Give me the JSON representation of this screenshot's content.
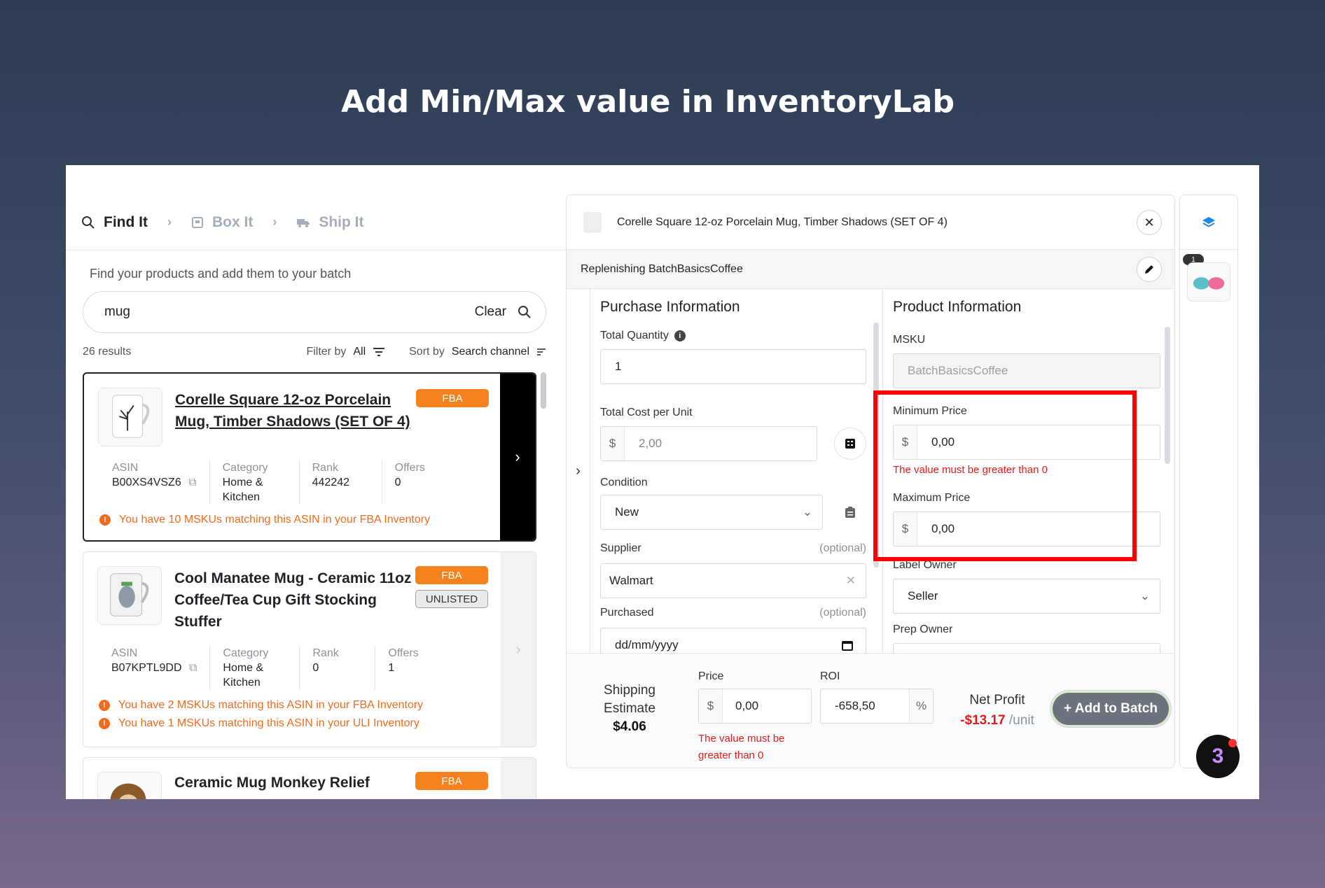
{
  "headline": "Add Min/Max value in InventoryLab",
  "steps": [
    {
      "label": "Find It",
      "icon": "search-icon",
      "active": true
    },
    {
      "label": "Box It",
      "icon": "box-icon",
      "active": false
    },
    {
      "label": "Ship It",
      "icon": "truck-icon",
      "active": false
    }
  ],
  "search": {
    "hint": "Find your products and add them to your batch",
    "value": "mug",
    "clear_label": "Clear"
  },
  "results": {
    "count": "26 results",
    "filter_label": "Filter by",
    "filter_value": "All",
    "sort_label": "Sort by",
    "sort_value": "Search channel"
  },
  "products": [
    {
      "title": "Corelle Square 12-oz Porcelain Mug, Timber Shadows (SET OF 4)",
      "badges": [
        "FBA"
      ],
      "asin_label": "ASIN",
      "asin": "B00XS4VSZ6",
      "category_label": "Category",
      "category": "Home & Kitchen",
      "rank_label": "Rank",
      "rank": "442242",
      "offers_label": "Offers",
      "offers": "0",
      "warnings": [
        "You have 10 MSKUs matching this ASIN in your FBA Inventory"
      ]
    },
    {
      "title": "Cool Manatee Mug - Ceramic 11oz Coffee/Tea Cup Gift Stocking Stuffer",
      "badges": [
        "FBA",
        "UNLISTED"
      ],
      "asin_label": "ASIN",
      "asin": "B07KPTL9DD",
      "category_label": "Category",
      "category": "Home & Kitchen",
      "rank_label": "Rank",
      "rank": "0",
      "offers_label": "Offers",
      "offers": "1",
      "warnings": [
        "You have 2 MSKUs matching this ASIN in your FBA Inventory",
        "You have 1 MSKUs matching this ASIN in your ULI Inventory"
      ]
    },
    {
      "title": "Ceramic Mug Monkey Relief",
      "badges": [
        "FBA"
      ]
    }
  ],
  "detail": {
    "title": "Corelle Square 12-oz Porcelain Mug, Timber Shadows (SET OF 4)",
    "batch": "Replenishing BatchBasicsCoffee",
    "purchase": {
      "heading": "Purchase Information",
      "total_quantity_label": "Total Quantity",
      "total_quantity": "1",
      "total_cost_label": "Total Cost per Unit",
      "currency": "$",
      "total_cost_placeholder": "2,00",
      "condition_label": "Condition",
      "condition": "New",
      "supplier_label": "Supplier",
      "optional": "(optional)",
      "supplier": "Walmart",
      "purchased_label": "Purchased",
      "purchased_placeholder": "dd/mm/yyyy"
    },
    "product": {
      "heading": "Product Information",
      "msku_label": "MSKU",
      "msku": "BatchBasicsCoffee",
      "min_price_label": "Minimum Price",
      "min_price": "0,00",
      "min_error": "The value must be greater than 0",
      "max_price_label": "Maximum Price",
      "max_price": "0,00",
      "label_owner_label": "Label Owner",
      "label_owner": "Seller",
      "prep_owner_label": "Prep Owner"
    },
    "footer": {
      "shipping_label": "Shipping Estimate",
      "shipping_value": "$4.06",
      "price_label": "Price",
      "price": "0,00",
      "price_error": "The value must be greater than 0",
      "roi_label": "ROI",
      "roi": "-658,50",
      "roi_unit": "%",
      "net_profit_label": "Net Profit",
      "net_profit": "-$13.17",
      "net_profit_unit": "/unit",
      "add_button": "+ Add to Batch"
    }
  },
  "side": {
    "count": "1"
  },
  "colors": {
    "fba": "#f6821f",
    "error": "#e21b1b",
    "highlight": "#ff0000"
  }
}
